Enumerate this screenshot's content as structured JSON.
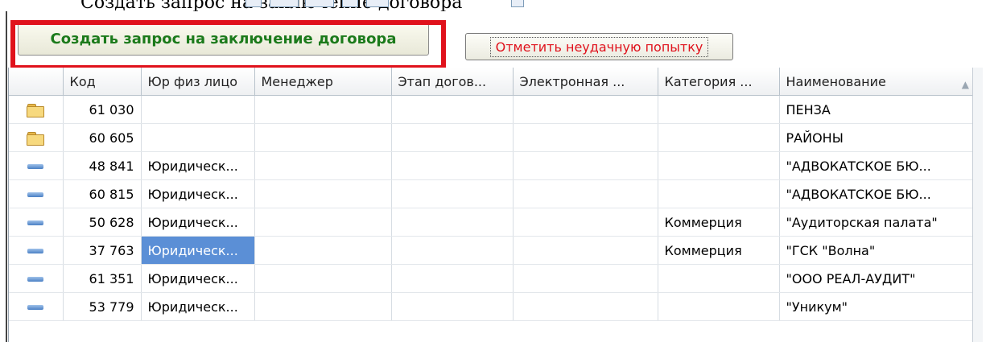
{
  "window": {
    "title": "Создать запрос на заключение договора"
  },
  "commands": {
    "create_request_label": "Создать запрос на заключение договора",
    "mark_failed_label": "Отметить неудачную попытку"
  },
  "colors": {
    "highlight_frame": "#e0121c",
    "create_text": "#1b7a1b",
    "fail_text": "#e0121c",
    "selection": "#5b8fd6"
  },
  "table": {
    "columns": [
      "",
      "Код",
      "Юр физ лицо",
      "Менеджер",
      "Этап догов...",
      "Электронная ...",
      "Категория ...",
      "Наименование"
    ],
    "sort_column": "Наименование",
    "sort_icon": "sort-ascending-icon",
    "rows": [
      {
        "icon": "folder-icon",
        "code": "61 030",
        "legal": "",
        "manager": "",
        "stage": "",
        "electronic": "",
        "category": "",
        "name": "ПЕНЗА"
      },
      {
        "icon": "folder-icon",
        "code": "60 605",
        "legal": "",
        "manager": "",
        "stage": "",
        "electronic": "",
        "category": "",
        "name": "РАЙОНЫ"
      },
      {
        "icon": "item-icon",
        "code": "48 841",
        "legal": "Юридическ...",
        "manager": "",
        "stage": "",
        "electronic": "",
        "category": "",
        "name": "\"АДВОКАТСКОЕ БЮ..."
      },
      {
        "icon": "item-icon",
        "code": "60 815",
        "legal": "Юридическ...",
        "manager": "",
        "stage": "",
        "electronic": "",
        "category": "",
        "name": "\"АДВОКАТСКОЕ БЮ..."
      },
      {
        "icon": "item-icon",
        "code": "50 628",
        "legal": "Юридическ...",
        "manager": "",
        "stage": "",
        "electronic": "",
        "category": "Коммерция",
        "name": "\"Аудиторская палата\""
      },
      {
        "icon": "item-icon",
        "code": "37 763",
        "legal": "Юридическ...",
        "manager": "",
        "stage": "",
        "electronic": "",
        "category": "Коммерция",
        "name": "\"ГСК \"Волна\"",
        "selected": true
      },
      {
        "icon": "item-icon",
        "code": "61 351",
        "legal": "Юридическ...",
        "manager": "",
        "stage": "",
        "electronic": "",
        "category": "",
        "name": "\"ООО РЕАЛ-АУДИТ\""
      },
      {
        "icon": "item-icon",
        "code": "53 779",
        "legal": "Юридическ...",
        "manager": "",
        "stage": "",
        "electronic": "",
        "category": "",
        "name": "\"Уникум\""
      }
    ]
  }
}
